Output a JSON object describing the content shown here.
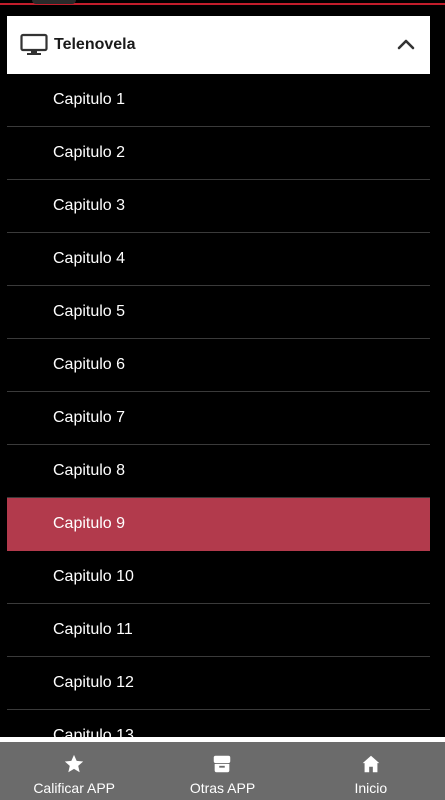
{
  "header": {
    "title": "Telenovela"
  },
  "chapters": [
    {
      "label": "Capitulo 1"
    },
    {
      "label": "Capitulo 2"
    },
    {
      "label": "Capitulo 3"
    },
    {
      "label": "Capitulo 4"
    },
    {
      "label": "Capitulo 5"
    },
    {
      "label": "Capitulo 6"
    },
    {
      "label": "Capitulo 7"
    },
    {
      "label": "Capitulo 8"
    },
    {
      "label": "Capitulo 9",
      "active": true
    },
    {
      "label": "Capitulo 10"
    },
    {
      "label": "Capitulo 11"
    },
    {
      "label": "Capitulo 12"
    },
    {
      "label": "Capitulo 13"
    }
  ],
  "bottom_nav": [
    {
      "label": "Calificar APP",
      "icon": "star-icon"
    },
    {
      "label": "Otras APP",
      "icon": "store-icon"
    },
    {
      "label": "Inicio",
      "icon": "home-icon"
    }
  ],
  "colors": {
    "accent_bar": "#c21d2b",
    "active_item": "#b23a4c",
    "background": "#000000",
    "nav_background": "#6b6b6b"
  }
}
